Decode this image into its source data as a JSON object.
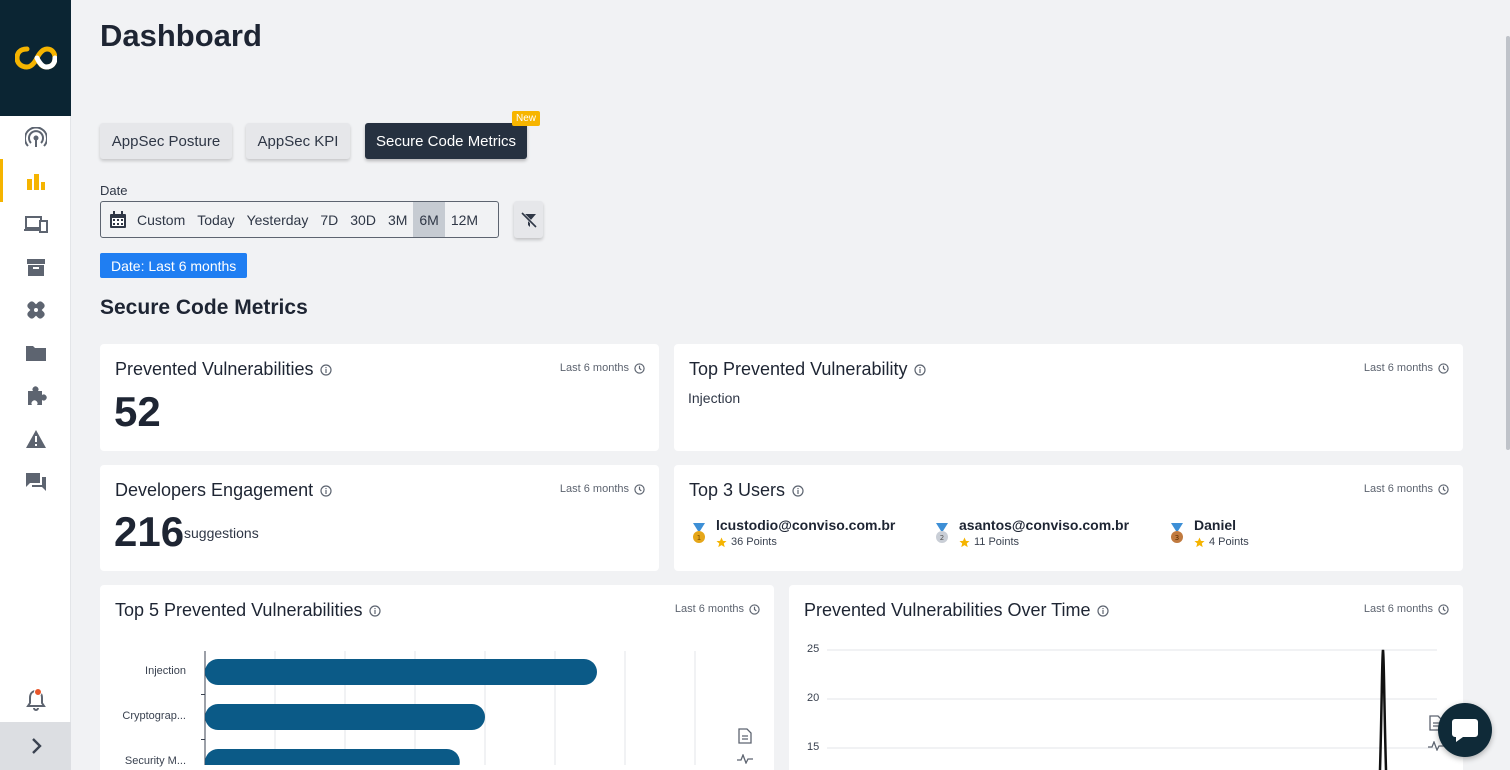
{
  "page": {
    "title": "Dashboard"
  },
  "sidebar": {
    "items": [
      {
        "icon": "radar-icon",
        "active": false
      },
      {
        "icon": "bar-chart-icon",
        "active": true
      },
      {
        "icon": "devices-icon",
        "active": false
      },
      {
        "icon": "archive-icon",
        "active": false
      },
      {
        "icon": "bandage-icon",
        "active": false
      },
      {
        "icon": "folder-icon",
        "active": false
      },
      {
        "icon": "puzzle-icon",
        "active": false
      },
      {
        "icon": "warning-icon",
        "active": false
      },
      {
        "icon": "chat-icon",
        "active": false
      }
    ],
    "accent": "#f5b400"
  },
  "tabs": [
    {
      "label": "AppSec Posture",
      "selected": false
    },
    {
      "label": "AppSec KPI",
      "selected": false
    },
    {
      "label": "Secure Code Metrics",
      "selected": true
    }
  ],
  "new_badge": "New",
  "date_filter": {
    "label": "Date",
    "options": [
      "Custom",
      "Today",
      "Yesterday",
      "7D",
      "30D",
      "3M",
      "6M",
      "12M"
    ],
    "selected": "6M",
    "chip": "Date: Last 6 months"
  },
  "section_title": "Secure Code Metrics",
  "period_label": "Last 6 months",
  "cards": {
    "prevented": {
      "title": "Prevented Vulnerabilities",
      "value": "52"
    },
    "top_prevented": {
      "title": "Top Prevented Vulnerability",
      "value": "Injection"
    },
    "engagement": {
      "title": "Developers Engagement",
      "value": "216",
      "unit": "suggestions"
    },
    "top_users": {
      "title": "Top 3 Users",
      "users": [
        {
          "email": "lcustodio@conviso.com.br",
          "points": "36 Points",
          "rank": "1"
        },
        {
          "email": "asantos@conviso.com.br",
          "points": "11 Points",
          "rank": "2"
        },
        {
          "name": "Daniel",
          "points": "4 Points",
          "rank": "3"
        }
      ]
    },
    "top5": {
      "title": "Top 5 Prevented Vulnerabilities"
    },
    "over_time": {
      "title": "Prevented Vulnerabilities Over Time"
    }
  },
  "chart_data": [
    {
      "type": "bar",
      "orientation": "horizontal",
      "title": "Top 5 Prevented Vulnerabilities",
      "categories": [
        "Injection",
        "Cryptograp...",
        "Security M..."
      ],
      "values": [
        28,
        20,
        18.2
      ],
      "xlim": [
        0,
        35
      ],
      "color": "#0b5a87",
      "grid": true
    },
    {
      "type": "line",
      "title": "Prevented Vulnerabilities Over Time",
      "yticks": [
        25,
        20,
        15
      ],
      "ylim": [
        12,
        25
      ],
      "series": [
        {
          "values": [
            25
          ]
        }
      ],
      "color": "#111111",
      "grid": true
    }
  ],
  "colors": {
    "tab_dark": "#263140",
    "chip": "#1f7ef2",
    "badge": "#f7b500",
    "bar": "#0b5a87",
    "logo_bg": "#0b2533"
  }
}
